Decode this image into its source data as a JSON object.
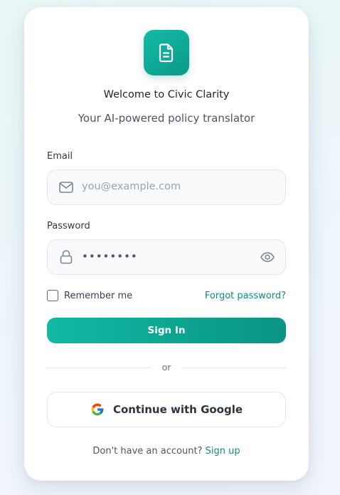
{
  "brand": {
    "logo_icon": "document-icon",
    "title": "Welcome to Civic Clarity",
    "subtitle": "Your AI-powered policy translator",
    "accent": "#0f9f8e"
  },
  "form": {
    "email": {
      "label": "Email",
      "placeholder": "you@example.com",
      "value": "",
      "icon": "mail-icon"
    },
    "password": {
      "label": "Password",
      "value": "••••••••",
      "icon": "lock-icon",
      "toggle_icon": "eye-icon"
    },
    "remember_label": "Remember me",
    "remember_checked": false,
    "forgot_label": "Forgot password?",
    "submit_label": "Sign In"
  },
  "divider_text": "or",
  "google": {
    "icon": "google-icon",
    "label": "Continue with Google"
  },
  "footer": {
    "prompt": "Don't have an account?",
    "link": "Sign up"
  }
}
